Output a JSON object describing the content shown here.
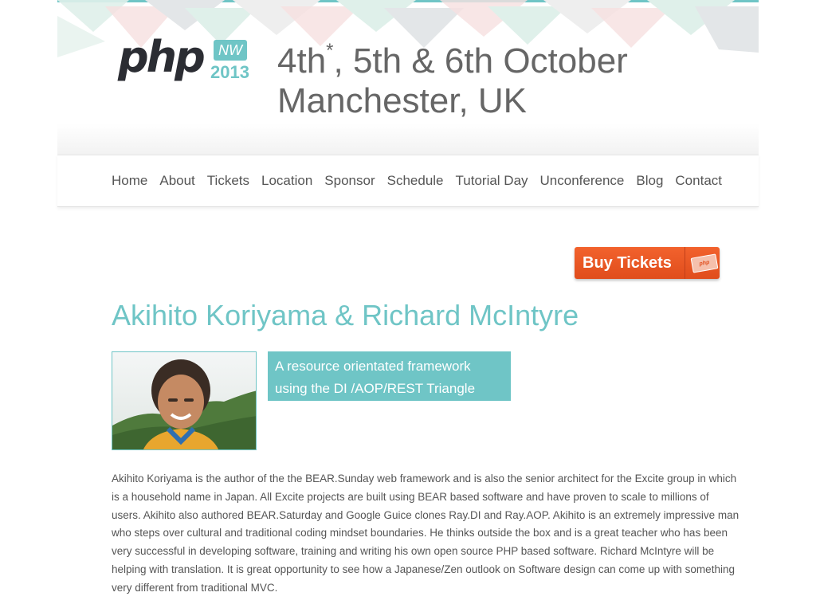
{
  "header": {
    "logo": {
      "php": "php",
      "badge": "NW",
      "year": "2013"
    },
    "headline": {
      "date_main": "4th",
      "date_mark": "*",
      "date_rest": ", 5th & 6th October",
      "location": "Manchester, UK"
    }
  },
  "nav": {
    "items": [
      "Home",
      "About",
      "Tickets",
      "Location",
      "Sponsor",
      "Schedule",
      "Tutorial Day",
      "Unconference",
      "Blog",
      "Contact"
    ]
  },
  "buy_tickets": {
    "label": "Buy Tickets",
    "badge": "php"
  },
  "speaker": {
    "name": "Akihito Koriyama & Richard McIntyre",
    "talk_title": "A resource orientated framework using the DI /AOP/REST Triangle",
    "bio": "Akihito Koriyama is the author of the the BEAR.Sunday web framework and is also the senior architect for the Excite group in which is a household name in Japan. All Excite projects are built using BEAR based software and have proven to scale to millions of users. Akihito also authored BEAR.Saturday and Google Guice clones Ray.DI and Ray.AOP. Akihito is an extremely impressive man who steps over cultural and traditional coding mindset boundaries. He thinks outside the box and is a great teacher who has been very successful in developing software, training and writing his own open source PHP based software. Richard McIntyre will be helping with translation. It is great opportunity to see how a Japanese/Zen outlook on Software design can come up with something very different from traditional MVC."
  },
  "colors": {
    "accent": "#6fc5c6",
    "buy_button": "#e8541f",
    "text": "#555555",
    "headline": "#666666",
    "logo_dark": "#2b2d33"
  }
}
